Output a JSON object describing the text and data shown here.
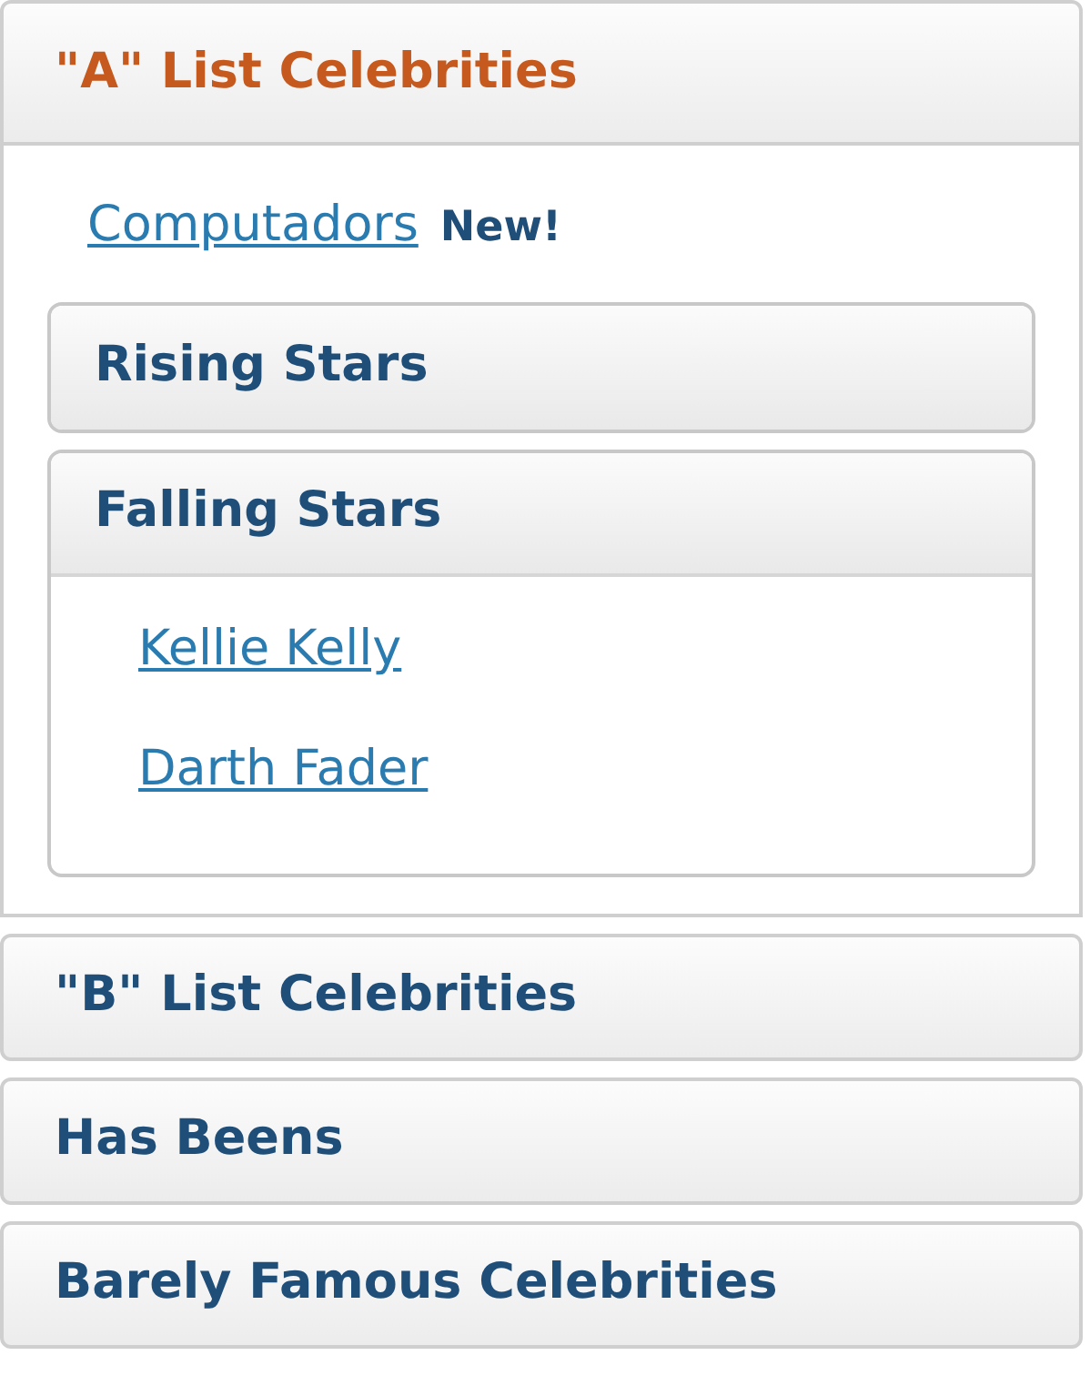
{
  "sections": [
    {
      "title": "\"A\" List Celebrities",
      "expanded": true,
      "items": [
        {
          "kind": "link",
          "label": "Computadors",
          "badge": "New!"
        },
        {
          "kind": "accordion",
          "title": "Rising Stars",
          "expanded": false
        },
        {
          "kind": "accordion",
          "title": "Falling Stars",
          "expanded": true,
          "links": [
            "Kellie Kelly",
            "Darth Fader"
          ]
        }
      ]
    },
    {
      "title": "\"B\" List Celebrities",
      "expanded": false
    },
    {
      "title": "Has Beens",
      "expanded": false
    },
    {
      "title": "Barely Famous Celebrities",
      "expanded": false
    }
  ]
}
